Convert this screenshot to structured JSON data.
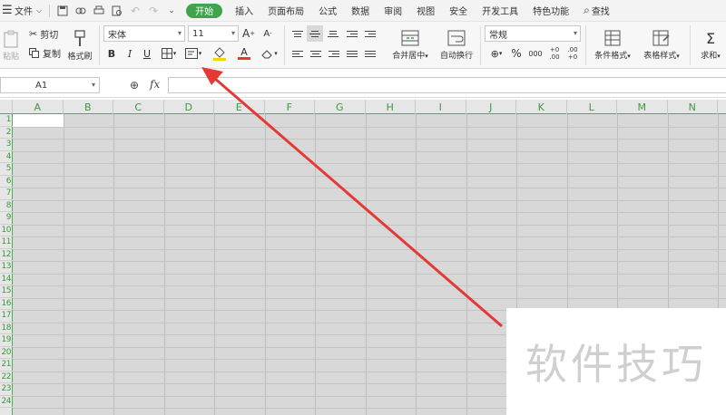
{
  "menu": {
    "file": "文件",
    "tabs": [
      "开始",
      "插入",
      "页面布局",
      "公式",
      "数据",
      "审阅",
      "视图",
      "安全",
      "开发工具",
      "特色功能"
    ],
    "active_tab": "开始",
    "search": "查找"
  },
  "ribbon": {
    "paste": "粘贴",
    "cut": "剪切",
    "copy": "复制",
    "format_painter": "格式刷",
    "font_name": "宋体",
    "font_size": "11",
    "bold": "B",
    "italic": "I",
    "underline": "U",
    "merge_center": "合并居中",
    "wrap_text": "自动换行",
    "number_format": "常规",
    "percent": "%",
    "thousands": "000",
    "inc_decimal": "+0 .00",
    "dec_decimal": ".00 +0",
    "conditional_format": "条件格式",
    "table_style": "表格样式",
    "sum": "求和"
  },
  "formula_bar": {
    "cell_ref": "A1",
    "fx": "fx",
    "value": ""
  },
  "sheet": {
    "columns": [
      "A",
      "B",
      "C",
      "D",
      "E",
      "F",
      "G",
      "H",
      "I",
      "J",
      "K",
      "L",
      "M",
      "N"
    ],
    "rows": [
      "1",
      "2",
      "3",
      "4",
      "5",
      "6",
      "7",
      "8",
      "9",
      "10",
      "11",
      "12",
      "13",
      "14",
      "15",
      "16",
      "17",
      "18",
      "19",
      "20",
      "21",
      "22",
      "23",
      "24"
    ]
  },
  "watermark": "软件技巧",
  "colors": {
    "accent": "#3fa44a",
    "header_text": "#3c9a3c",
    "grid_bg": "#d8d8d8",
    "arrow": "#e53935"
  },
  "icons": {
    "menu": "hamburger-icon",
    "save": "save-icon",
    "print": "print-icon",
    "preview": "print-preview-icon",
    "undo": "undo-icon",
    "redo": "redo-icon",
    "search": "search-icon",
    "cut": "scissors-icon",
    "copy": "copy-icon",
    "paste": "paste-icon",
    "format_painter": "brush-icon",
    "borders": "border-icon",
    "fill": "fill-color-icon",
    "font_color": "font-color-icon",
    "clear": "eraser-icon"
  }
}
